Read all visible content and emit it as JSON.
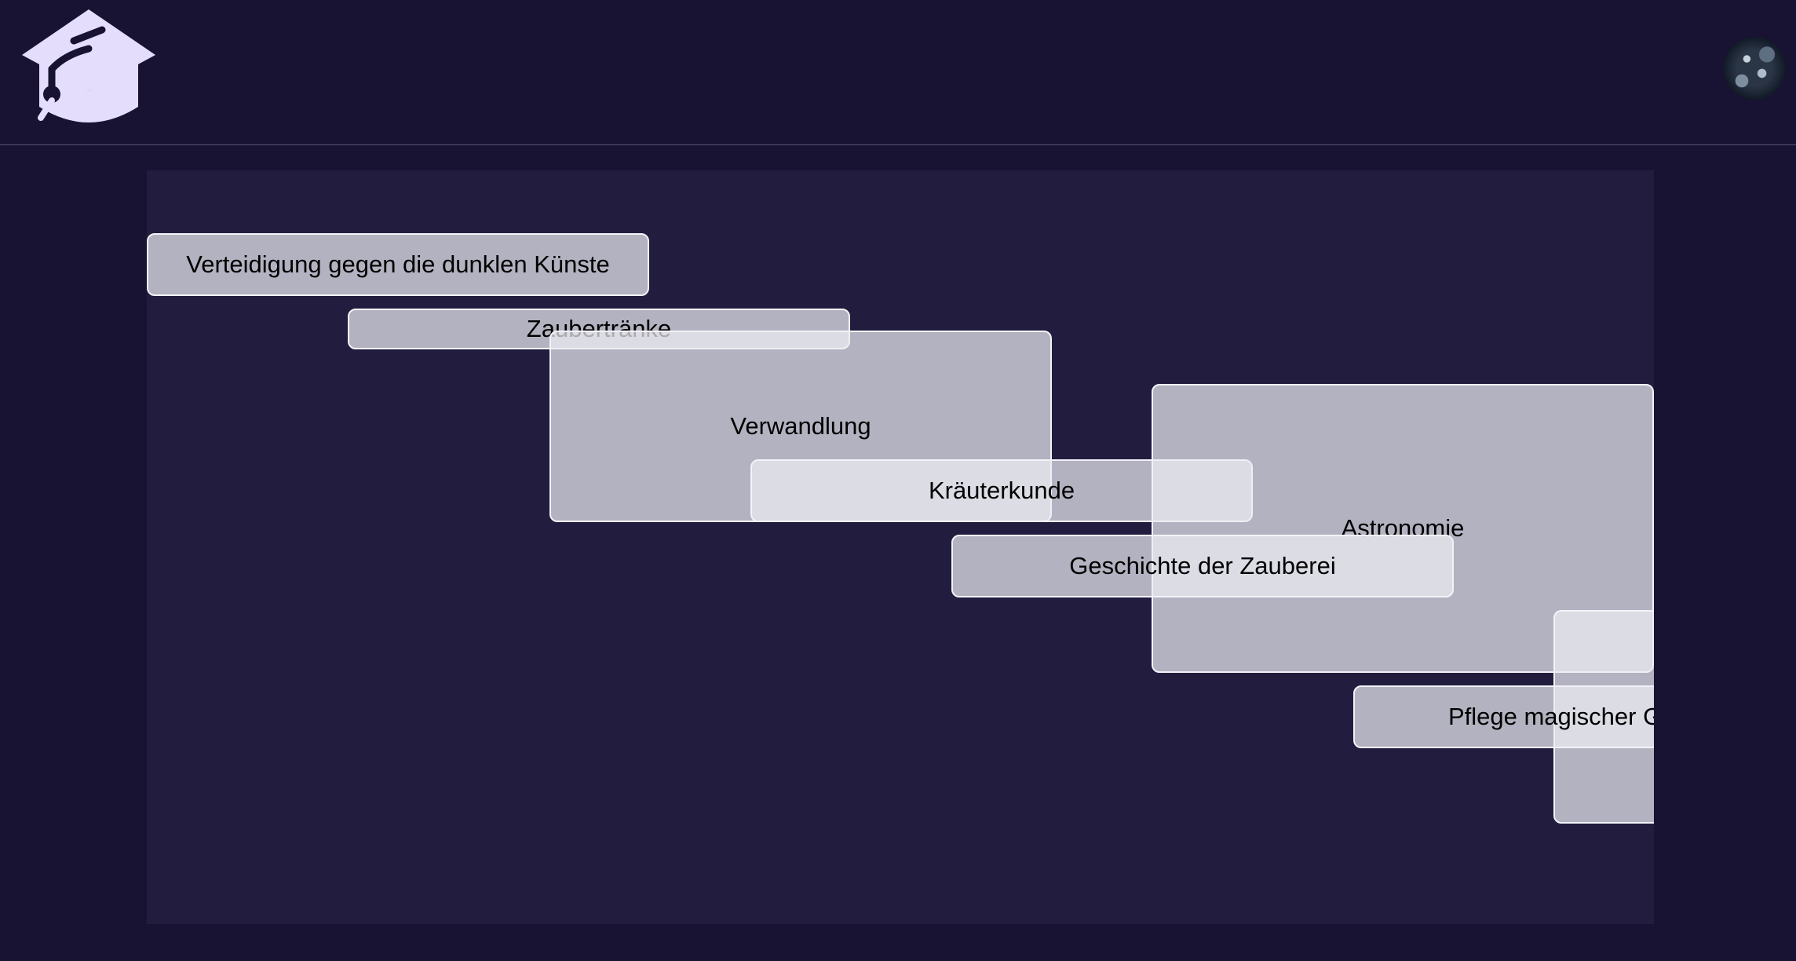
{
  "header": {
    "logo_icon": "graduation-cap-icon",
    "avatar_icon": "user-avatar"
  },
  "courses": [
    {
      "label": "Verteidigung gegen die dunklen Künste"
    },
    {
      "label": "Zaubertränke"
    },
    {
      "label": "Verwandlung"
    },
    {
      "label": "Kräuterkunde"
    },
    {
      "label": "Astronomie"
    },
    {
      "label": "Geschichte der Zauberei"
    },
    {
      "label": ""
    },
    {
      "label": "Pflege magischer Geschöpfe"
    }
  ],
  "colors": {
    "background": "#181333",
    "stage": "#221d3e",
    "logo": "#e4defc",
    "block_fill": "#ecebf2",
    "block_border": "#f3f2f8"
  }
}
